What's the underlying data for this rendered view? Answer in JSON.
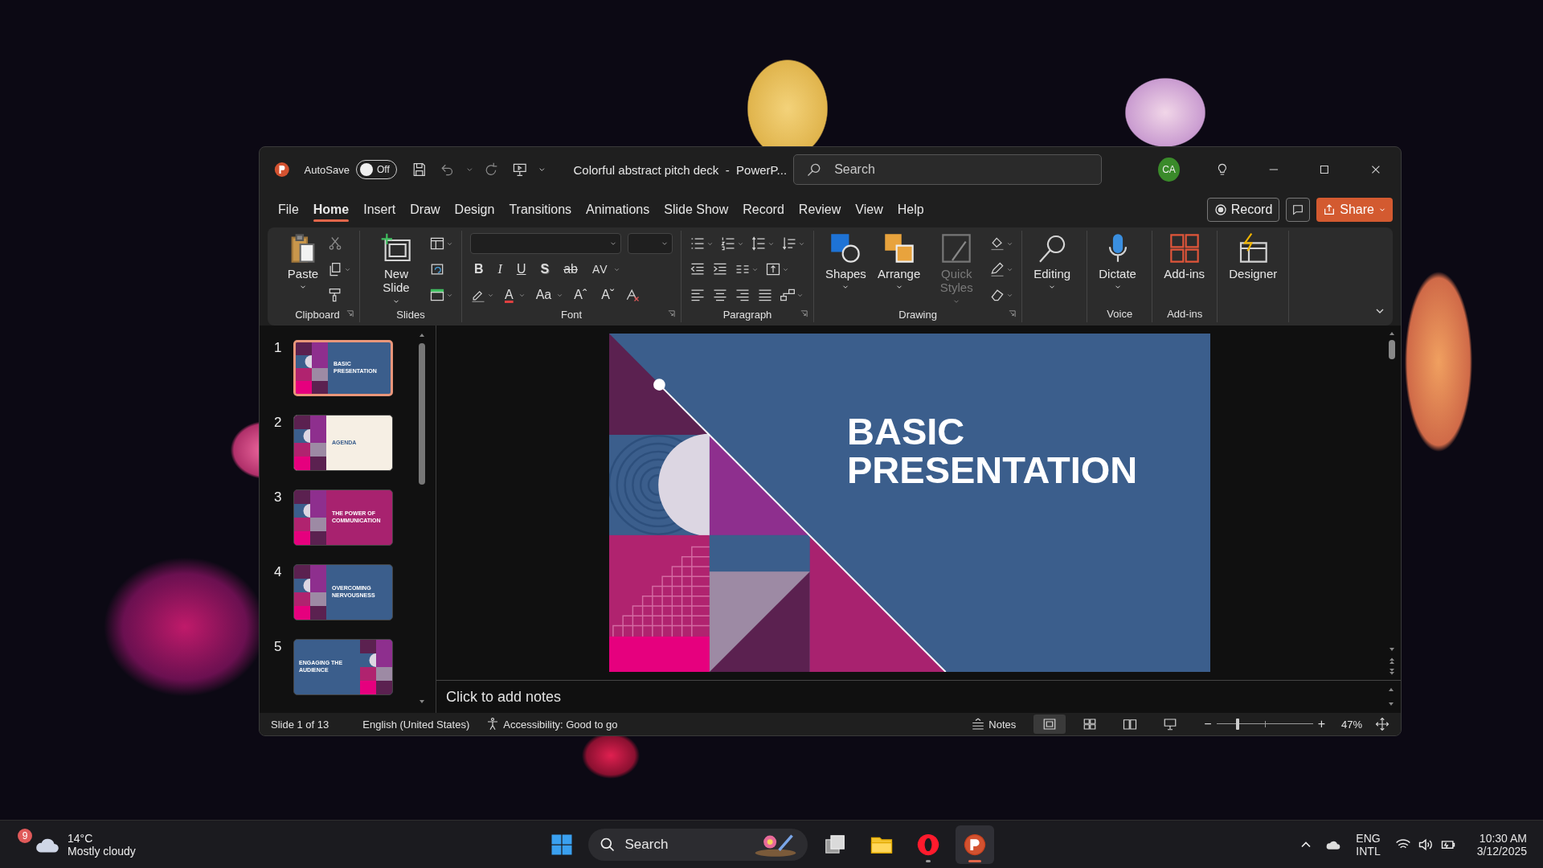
{
  "window": {
    "title": "Colorful abstract pitch deck  -  PowerP...",
    "autosave": {
      "label": "AutoSave",
      "on": false,
      "state_label": "Off"
    },
    "search": {
      "placeholder": "Search"
    },
    "account": {
      "initials": "CA"
    }
  },
  "menu_tabs": [
    {
      "label": "File",
      "selected": false
    },
    {
      "label": "Home",
      "selected": true
    },
    {
      "label": "Insert",
      "selected": false
    },
    {
      "label": "Draw",
      "selected": false
    },
    {
      "label": "Design",
      "selected": false
    },
    {
      "label": "Transitions",
      "selected": false
    },
    {
      "label": "Animations",
      "selected": false
    },
    {
      "label": "Slide Show",
      "selected": false
    },
    {
      "label": "Record",
      "selected": false
    },
    {
      "label": "Review",
      "selected": false
    },
    {
      "label": "View",
      "selected": false
    },
    {
      "label": "Help",
      "selected": false
    }
  ],
  "tab_actions": {
    "record": "Record",
    "share": "Share"
  },
  "ribbon": {
    "groups": [
      {
        "label": "Clipboard",
        "buttons": [
          {
            "label": "Paste",
            "disabled": false
          }
        ]
      },
      {
        "label": "Slides",
        "buttons": [
          {
            "label": "New Slide",
            "disabled": false
          }
        ]
      },
      {
        "label": "Font",
        "format_letters": [
          "B",
          "I",
          "U",
          "S",
          "ab",
          "AV"
        ],
        "style_letters": [
          "A",
          "Aa",
          "Aˆ",
          "Aˇ"
        ]
      },
      {
        "label": "Paragraph"
      },
      {
        "label": "Drawing",
        "buttons": [
          {
            "label": "Shapes",
            "disabled": false
          },
          {
            "label": "Arrange",
            "disabled": false
          },
          {
            "label": "Quick Styles",
            "disabled": true
          }
        ]
      },
      {
        "buttons": [
          {
            "label": "Editing",
            "disabled": false
          }
        ]
      },
      {
        "label": "Voice",
        "buttons": [
          {
            "label": "Dictate",
            "disabled": false
          }
        ]
      },
      {
        "label": "Add-ins",
        "buttons": [
          {
            "label": "Add-ins",
            "disabled": false
          }
        ]
      },
      {
        "buttons": [
          {
            "label": "Designer",
            "disabled": false
          }
        ]
      }
    ]
  },
  "slides": [
    {
      "number": "1",
      "selected": true,
      "title": "BASIC PRESENTATION"
    },
    {
      "number": "2",
      "selected": false,
      "title": "AGENDA"
    },
    {
      "number": "3",
      "selected": false,
      "title": "THE POWER OF COMMUNICATION"
    },
    {
      "number": "4",
      "selected": false,
      "title": "OVERCOMING NERVOUSNESS"
    },
    {
      "number": "5",
      "selected": false,
      "title": "ENGAGING THE AUDIENCE"
    }
  ],
  "main_slide": {
    "title_lines": [
      "BASIC",
      "PRESENTATION"
    ]
  },
  "notes": {
    "placeholder": "Click to add notes"
  },
  "status_bar": {
    "slide_position": "Slide 1 of 13",
    "language": "English (United States)",
    "accessibility": "Accessibility: Good to go",
    "notes": "Notes",
    "views": [
      {
        "selected": true
      },
      {
        "selected": false
      },
      {
        "selected": false
      },
      {
        "selected": false
      }
    ],
    "zoom_out": "−",
    "zoom_in": "+",
    "zoom": {
      "level": 0.22
    },
    "zoom_percent": "47%"
  },
  "taskbar": {
    "weather": {
      "badge": "9",
      "temperature": "14°C",
      "condition": "Mostly cloudy"
    },
    "search": {
      "placeholder": "Search"
    },
    "apps": [
      {
        "running": false,
        "active": false
      },
      {
        "running": false,
        "active": false
      },
      {
        "running": true,
        "active": false
      },
      {
        "running": true,
        "active": true
      }
    ],
    "tray": {
      "language": "ENG",
      "layout": "INTL",
      "time": "10:30 AM",
      "date": "3/12/2025"
    }
  }
}
